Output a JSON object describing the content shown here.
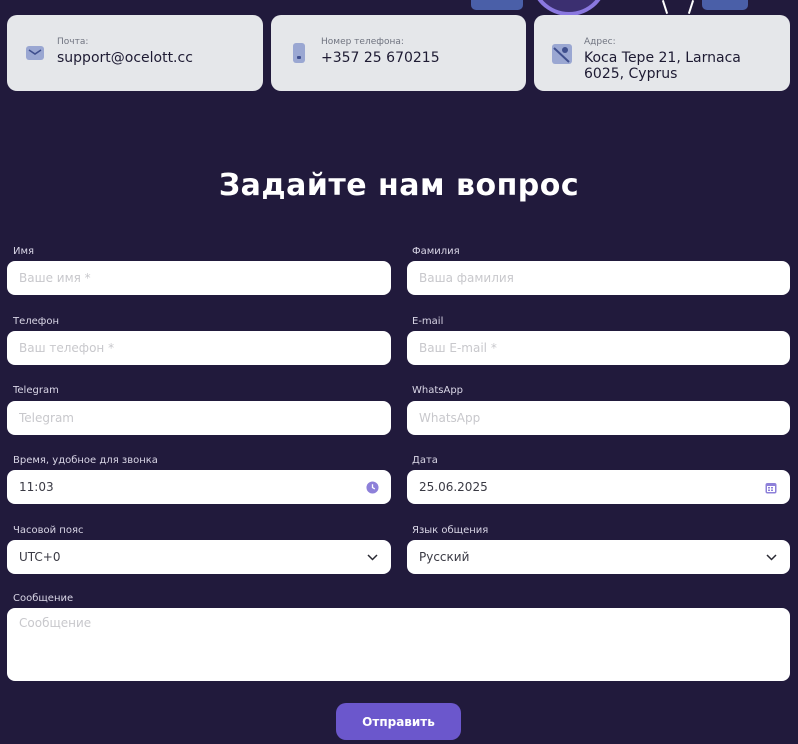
{
  "contacts": [
    {
      "label": "Почта:",
      "value": "support@ocelott.cc",
      "icon": "mail-icon"
    },
    {
      "label": "Номер телефона:",
      "value": "+357 25 670215",
      "icon": "phone-icon"
    },
    {
      "label": "Адрес:",
      "value": "Koca Tepe 21, Larnaca 6025, Cyprus",
      "icon": "map-icon"
    }
  ],
  "form": {
    "title": "Задайте нам вопрос",
    "first_name": {
      "label": "Имя",
      "placeholder": "Ваше имя *"
    },
    "last_name": {
      "label": "Фамилия",
      "placeholder": "Ваша фамилия"
    },
    "phone": {
      "label": "Телефон",
      "placeholder": "Ваш телефон *"
    },
    "email": {
      "label": "E-mail",
      "placeholder": "Ваш E-mail *"
    },
    "telegram": {
      "label": "Telegram",
      "placeholder": "Telegram"
    },
    "whatsapp": {
      "label": "WhatsApp",
      "placeholder": "WhatsApp"
    },
    "call_time": {
      "label": "Время, удобное для звонка",
      "value": "11:03"
    },
    "date": {
      "label": "Дата",
      "value": "25.06.2025"
    },
    "timezone": {
      "label": "Часовой пояс",
      "value": "UTC+0"
    },
    "language": {
      "label": "Язык общения",
      "value": "Русский"
    },
    "message": {
      "label": "Сообщение",
      "placeholder": "Сообщение"
    },
    "submit_label": "Отправить"
  },
  "colors": {
    "background": "#211a3c",
    "accent": "#6b57cc",
    "card": "#e5e7ea"
  }
}
